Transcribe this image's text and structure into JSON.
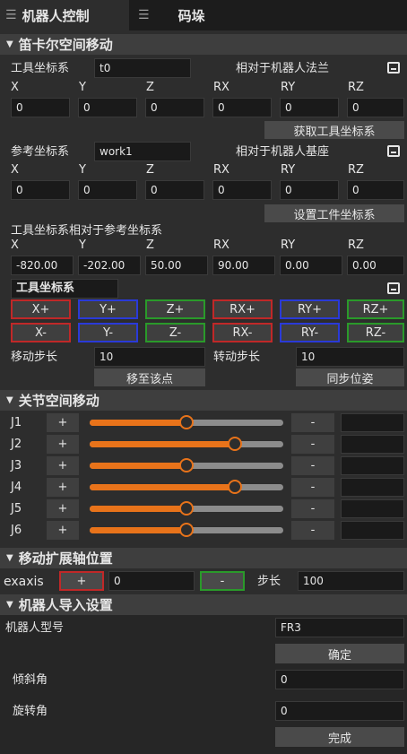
{
  "tabs": [
    {
      "icon": "list-icon",
      "label": "机器人控制"
    },
    {
      "icon": "list-icon",
      "label": "码垛"
    }
  ],
  "cartesian": {
    "title": "笛卡尔空间移动",
    "axes": [
      "X",
      "Y",
      "Z",
      "RX",
      "RY",
      "RZ"
    ],
    "tool_label": "工具坐标系",
    "tool_value": "t0",
    "tool_rel": "相对于机器人法兰",
    "tool_values": [
      "0",
      "0",
      "0",
      "0",
      "0",
      "0"
    ],
    "get_tool_btn": "获取工具坐标系",
    "ref_label": "参考坐标系",
    "ref_value": "work1",
    "ref_rel": "相对于机器人基座",
    "ref_values": [
      "0",
      "0",
      "0",
      "0",
      "0",
      "0"
    ],
    "set_work_btn": "设置工件坐标系",
    "rel_label": "工具坐标系相对于参考坐标系",
    "rel_values": [
      "-820.00",
      "-202.00",
      "50.00",
      "90.00",
      "0.00",
      "0.00"
    ],
    "frame_select": "工具坐标系",
    "plus": [
      "X+",
      "Y+",
      "Z+",
      "RX+",
      "RY+",
      "RZ+"
    ],
    "minus": [
      "X-",
      "Y-",
      "Z-",
      "RX-",
      "RY-",
      "RZ-"
    ],
    "move_step_label": "移动步长",
    "move_step": "10",
    "rot_step_label": "转动步长",
    "rot_step": "10",
    "move_to_btn": "移至该点",
    "sync_btn": "同步位姿"
  },
  "joint": {
    "title": "关节空间移动",
    "plus": "+",
    "minus": "-",
    "joints": [
      {
        "name": "J1",
        "level": 0.5
      },
      {
        "name": "J2",
        "level": 0.75
      },
      {
        "name": "J3",
        "level": 0.5
      },
      {
        "name": "J4",
        "level": 0.75
      },
      {
        "name": "J5",
        "level": 0.5
      },
      {
        "name": "J6",
        "level": 0.5
      }
    ]
  },
  "exaxis": {
    "title": "移动扩展轴位置",
    "label": "exaxis",
    "plus": "+",
    "value": "0",
    "minus": "-",
    "step_label": "步长",
    "step": "100"
  },
  "import": {
    "title": "机器人导入设置",
    "model_label": "机器人型号",
    "model_value": "FR3",
    "confirm_btn": "确定",
    "tilt_label": "倾斜角",
    "tilt_value": "0",
    "rot_label": "旋转角",
    "rot_value": "0",
    "done_btn": "完成"
  },
  "colors": {
    "accent": "#e8731a",
    "red": "#c02828",
    "blue": "#2a3ad8",
    "green": "#2a9a2a"
  }
}
